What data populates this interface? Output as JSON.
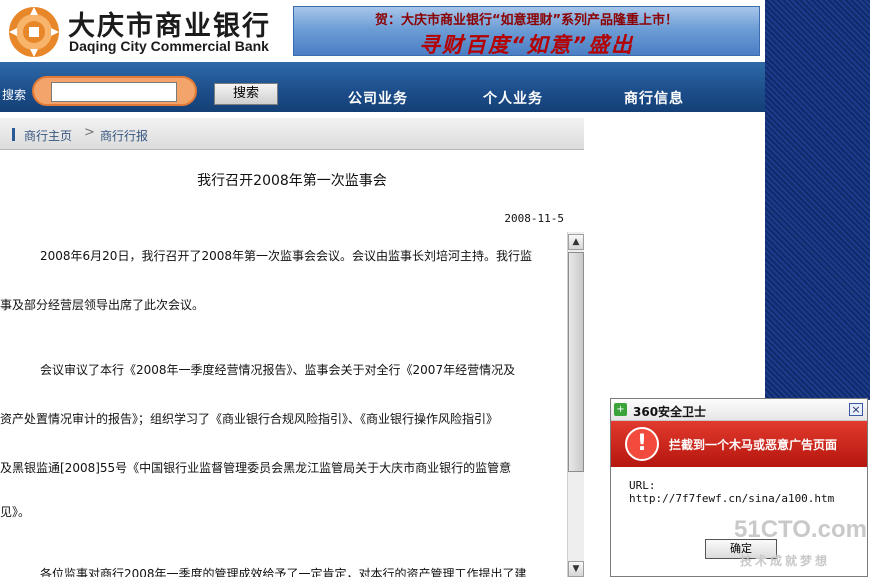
{
  "header": {
    "logo_cn": "大庆市商业银行",
    "logo_en": "Daqing City Commercial Bank",
    "banner_top": "贺：大庆市商业银行“如意理财”系列产品隆重上市！",
    "banner_bottom": "寻财百度“如意”盛出"
  },
  "nav": {
    "search_label": "搜索",
    "search_value": "",
    "search_button": "搜索",
    "items": [
      "公司业务",
      "个人业务",
      "商行信息"
    ]
  },
  "breadcrumb": {
    "home": "商行主页",
    "separator": ">",
    "current": "商行行报"
  },
  "article": {
    "title": "我行召开2008年第一次监事会",
    "date": "2008-11-5",
    "lines": [
      "2008年6月20日，我行召开了2008年第一次监事会会议。会议由监事长刘培河主持。我行监",
      "事及部分经营层领导出席了此次会议。",
      "会议审议了本行《2008年一季度经营情况报告》、监事会关于对全行《2007年经营情况及",
      "资产处置情况审计的报告》；组织学习了《商业银行合规风险指引》、《商业银行操作风险指引》",
      "及黑银监通[2008]55号《中国银行业监督管理委员会黑龙江监管局关于大庆市商业银行的监管意",
      "见》。",
      "各位监事对商行2008年一季度的管理成效给予了一定肯定，对本行的资产管理工作提出了建"
    ]
  },
  "popup": {
    "title": "360安全卫士",
    "close": "×",
    "alert": "拦截到一个木马或恶意广告页面",
    "alert_symbol": "!",
    "url_label": "URL:",
    "url": "http://7f7fewf.cn/sina/a100.htm",
    "ok_button": "确定"
  },
  "watermark": {
    "main": "51CTO.com",
    "sub": "技术成就梦想"
  },
  "colors": {
    "navbar": "#1d4f8c",
    "alert": "#c8241a",
    "logo_orange": "#e8862a"
  }
}
